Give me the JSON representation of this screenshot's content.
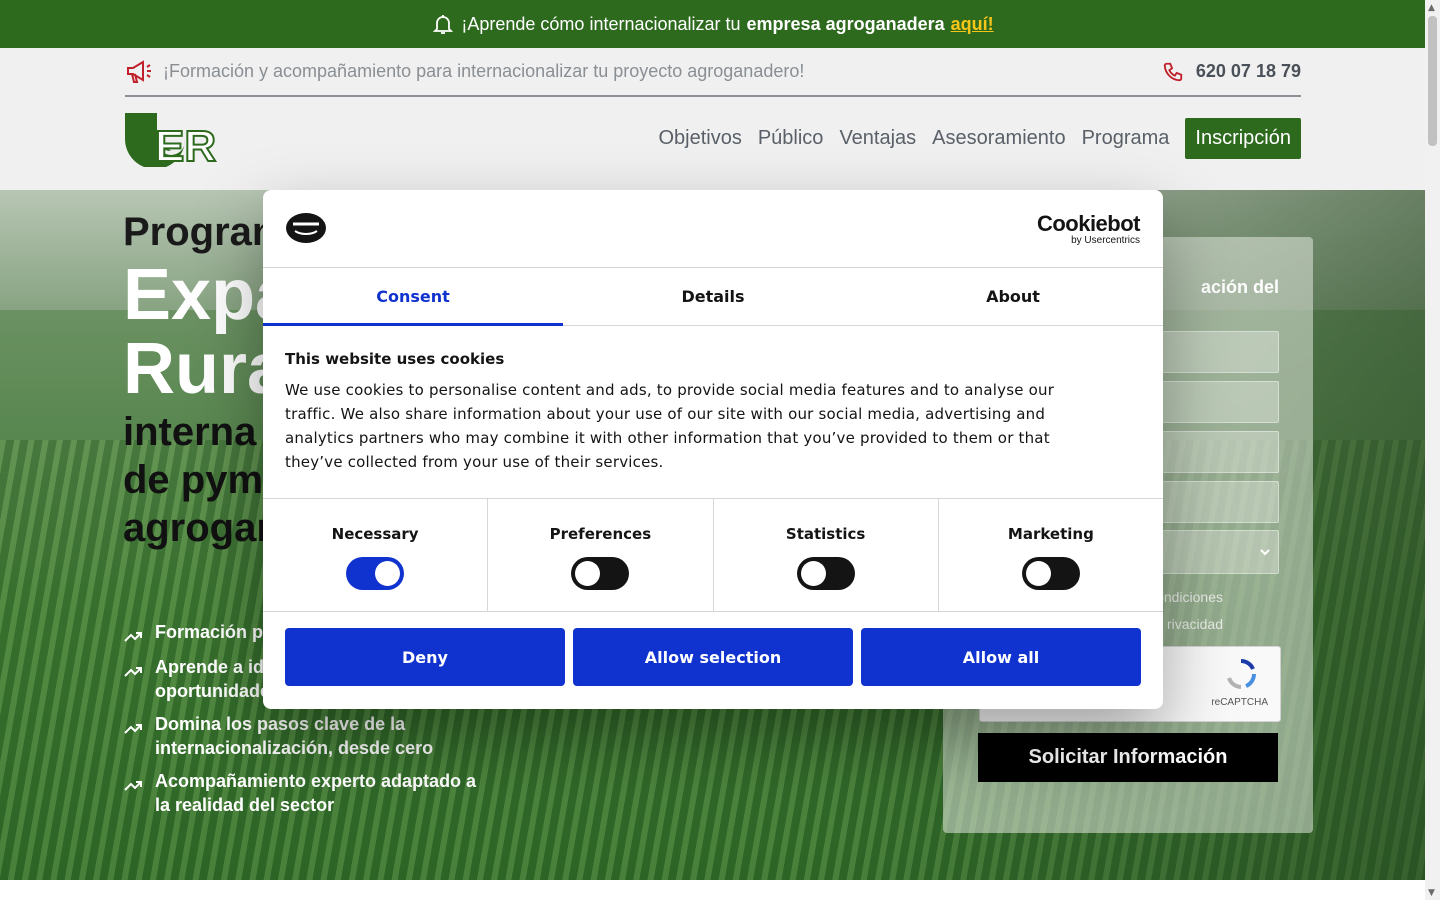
{
  "promo": {
    "text": "¡Aprende cómo internacionalizar tu ",
    "bold": "empresa agroganadera",
    "link": "aquí!"
  },
  "topbar": {
    "tagline": "¡Formación y acompañamiento para internacionalizar tu proyecto agroganadero!",
    "phone": "620 07 18 79"
  },
  "logo": {
    "text": "ER"
  },
  "nav": {
    "items": [
      "Objetivos",
      "Público",
      "Ventajas",
      "Asesoramiento",
      "Programa"
    ],
    "cta": "Inscripción"
  },
  "hero": {
    "small": "Program",
    "big1": "Expa",
    "big2": "Rura",
    "mid": [
      "interna",
      "de pym",
      "agrogar"
    ],
    "bullets": [
      "Formación pr productos ag",
      "Aprende a ide clientes y oportunidades reales",
      "Domina los pasos clave de la internacionalización, desde cero",
      "Acompañamiento experto adaptado a la realidad del sector"
    ]
  },
  "form": {
    "title": "ación del",
    "check1": "ondiciones",
    "check2": "rivacidad",
    "captcha": "reCAPTCHA",
    "submit": "Solicitar Información"
  },
  "cookie": {
    "brand": "Cookiebot",
    "brand_sub": "by Usercentrics",
    "tabs": [
      "Consent",
      "Details",
      "About"
    ],
    "heading": "This website uses cookies",
    "body": "We use cookies to personalise content and ads, to provide social media features and to analyse our traffic. We also share information about your use of our site with our social media, advertising and analytics partners who may combine it with other information that you’ve provided to them or that they’ve collected from your use of their services.",
    "toggles": [
      {
        "label": "Necessary",
        "on": true
      },
      {
        "label": "Preferences",
        "on": false
      },
      {
        "label": "Statistics",
        "on": false
      },
      {
        "label": "Marketing",
        "on": false
      }
    ],
    "buttons": {
      "deny": "Deny",
      "selection": "Allow selection",
      "all": "Allow all"
    },
    "accent": "#1032cf"
  },
  "colors": {
    "brand_green": "#2d6a1e",
    "promo_link": "#f5c518"
  }
}
